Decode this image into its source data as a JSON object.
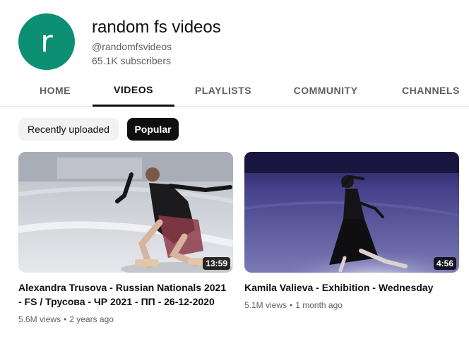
{
  "channel": {
    "avatar_letter": "r",
    "name": "random fs videos",
    "handle": "@randomfsvideos",
    "subscribers": "65.1K subscribers",
    "avatar_color": "#0d8f74"
  },
  "tabs": [
    {
      "label": "HOME",
      "active": false
    },
    {
      "label": "VIDEOS",
      "active": true
    },
    {
      "label": "PLAYLISTS",
      "active": false
    },
    {
      "label": "COMMUNITY",
      "active": false
    },
    {
      "label": "CHANNELS",
      "active": false
    }
  ],
  "chips": [
    {
      "label": "Recently uploaded",
      "selected": false
    },
    {
      "label": "Popular",
      "selected": true
    }
  ],
  "videos": [
    {
      "title": "Alexandra Trusova - Russian Nationals 2021 - FS / Трусова - ЧР 2021 - ПП - 26-12-2020",
      "duration": "13:59",
      "views": "5.6M views",
      "age": "2 years ago"
    },
    {
      "title": "Kamila Valieva - Exhibition - Wednesday",
      "duration": "4:56",
      "views": "5.1M views",
      "age": "1 month ago"
    }
  ],
  "meta_separator": "•"
}
